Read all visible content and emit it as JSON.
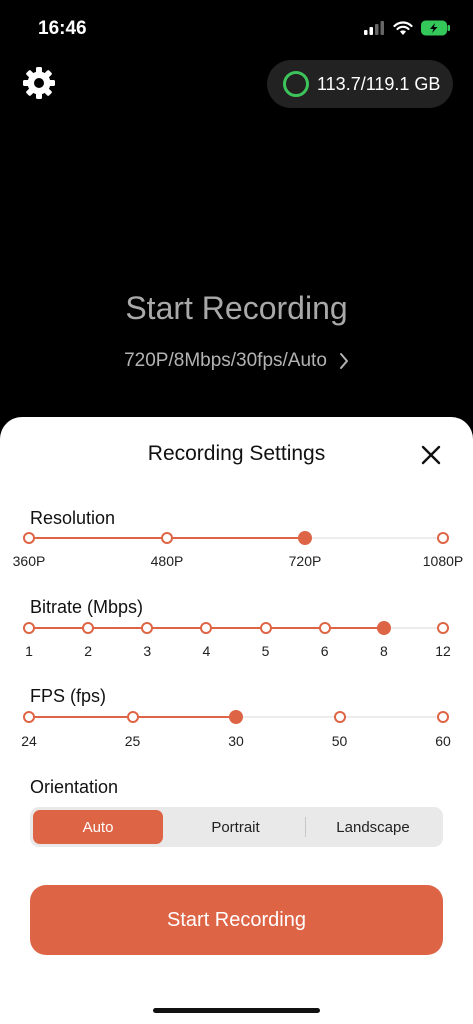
{
  "status_bar": {
    "time": "16:46"
  },
  "top": {
    "storage_text": "113.7/119.1 GB"
  },
  "hero": {
    "title": "Start Recording",
    "summary": "720P/8Mbps/30fps/Auto"
  },
  "sheet": {
    "title": "Recording Settings",
    "resolution": {
      "label": "Resolution",
      "options": [
        "360P",
        "480P",
        "720P",
        "1080P"
      ],
      "selected": 2
    },
    "bitrate": {
      "label": "Bitrate (Mbps)",
      "options": [
        "1",
        "2",
        "3",
        "4",
        "5",
        "6",
        "8",
        "12"
      ],
      "selected": 6
    },
    "fps": {
      "label": "FPS (fps)",
      "options": [
        "24",
        "25",
        "30",
        "50",
        "60"
      ],
      "selected": 2
    },
    "orientation": {
      "label": "Orientation",
      "options": [
        "Auto",
        "Portrait",
        "Landscape"
      ],
      "selected": 0
    },
    "start_button": "Start Recording"
  },
  "colors": {
    "accent": "#de6446",
    "storage_ring": "#3dc45a",
    "battery": "#34c759"
  }
}
